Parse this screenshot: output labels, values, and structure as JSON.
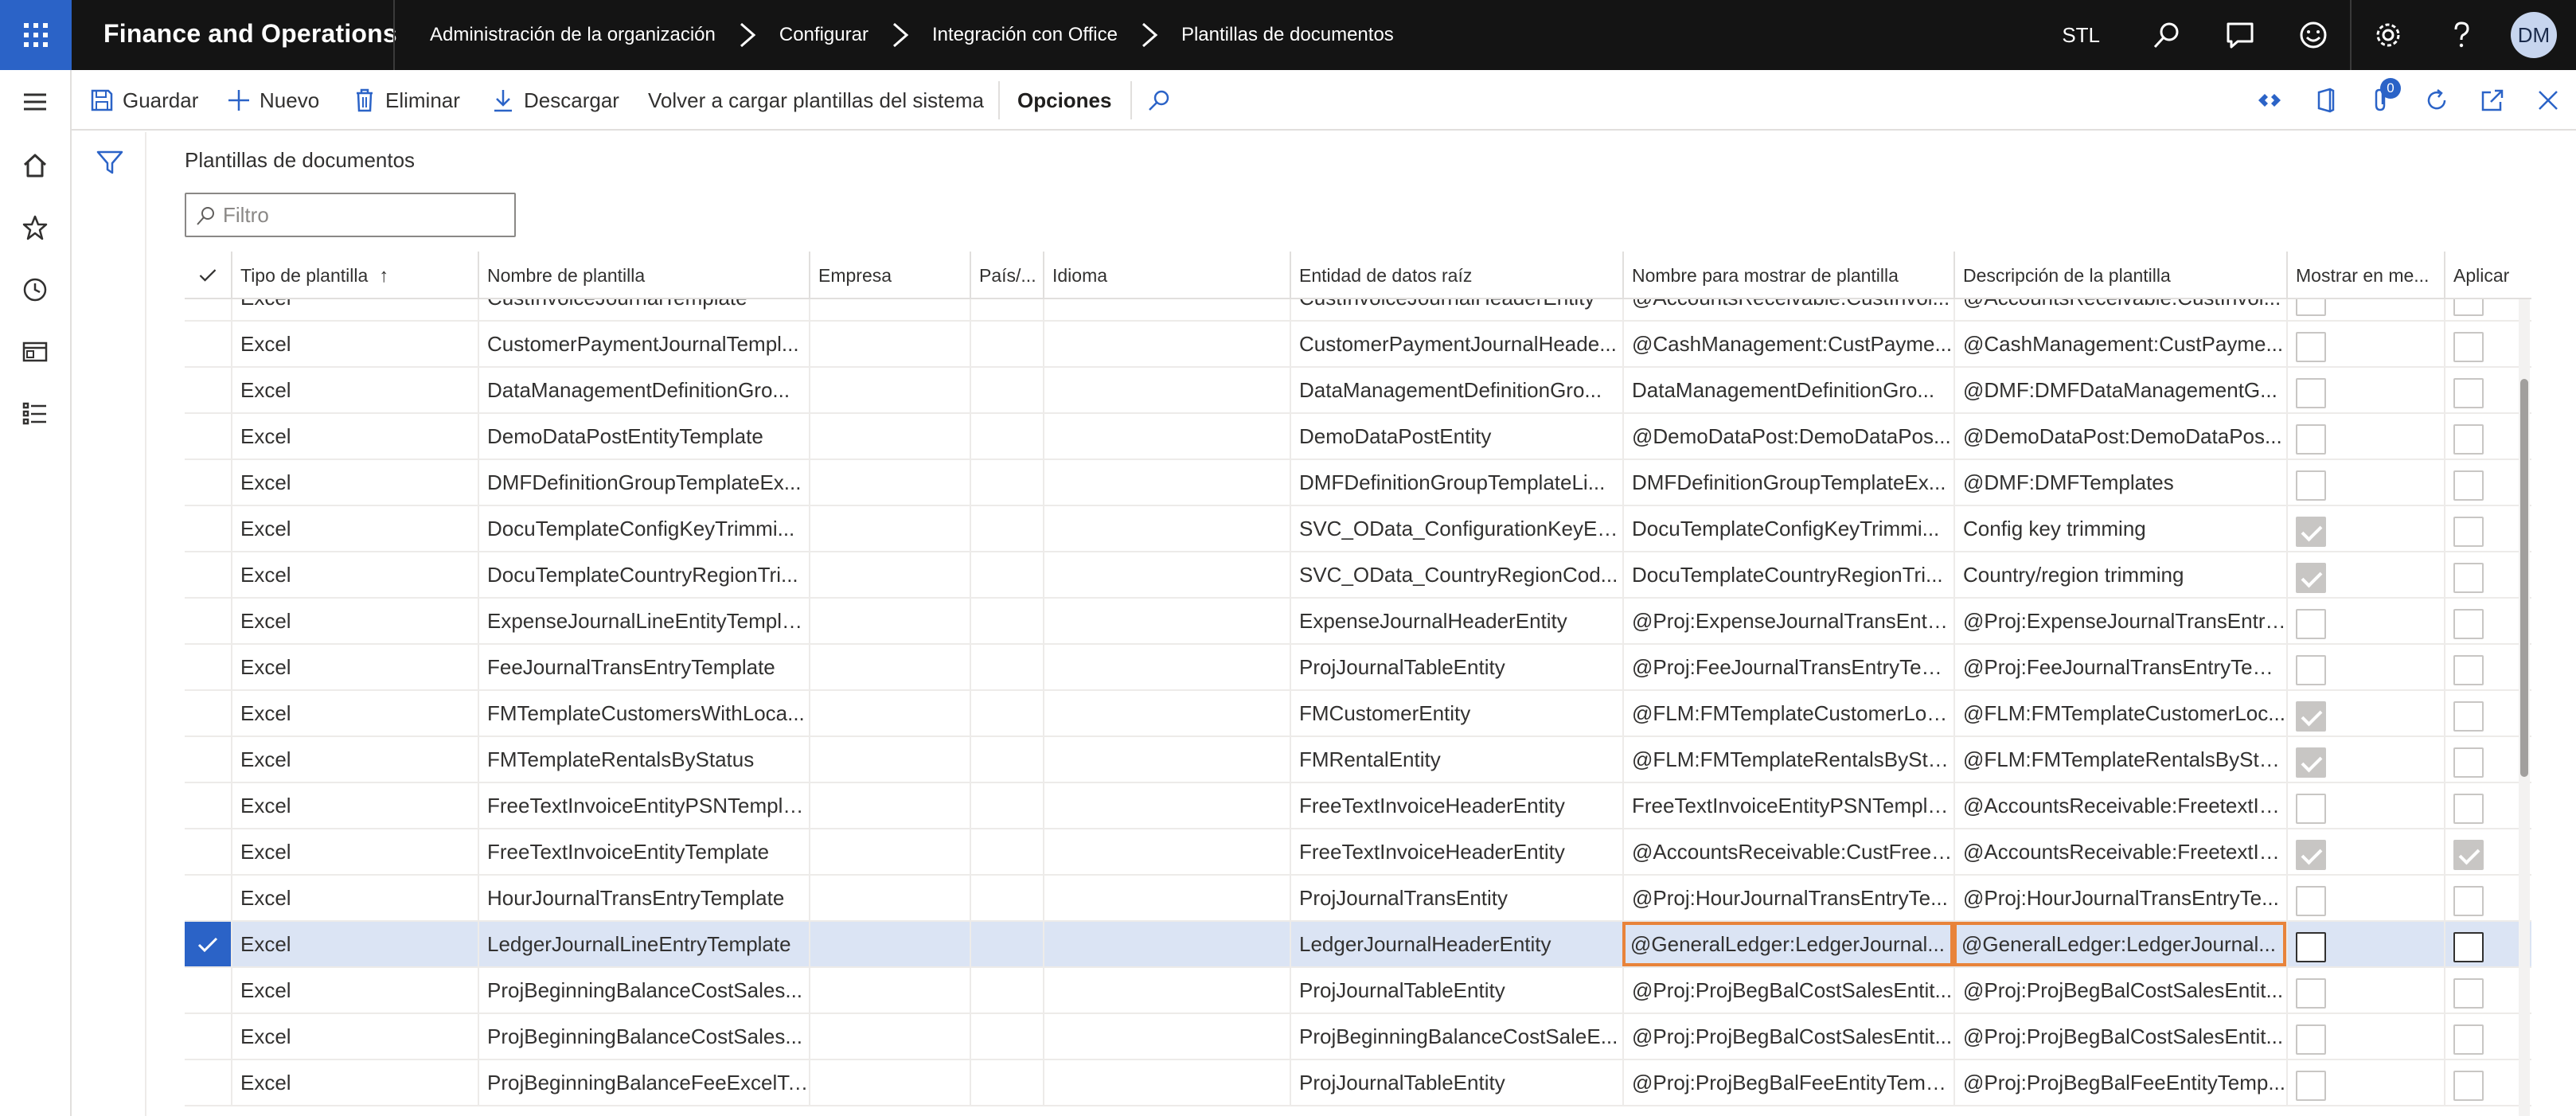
{
  "app": {
    "title": "Finance and Operations",
    "company": "STL",
    "avatar_initials": "DM",
    "accent_color": "#2b63c7",
    "highlight_color": "#e8833a"
  },
  "breadcrumb": [
    "Administración de la organización",
    "Configurar",
    "Integración con Office",
    "Plantillas de documentos"
  ],
  "actions": {
    "save": "Guardar",
    "new": "Nuevo",
    "delete": "Eliminar",
    "download": "Descargar",
    "reload": "Volver a cargar plantillas del sistema",
    "options": "Opciones"
  },
  "notification_count": "0",
  "page": {
    "title": "Plantillas de documentos",
    "filter_placeholder": "Filtro"
  },
  "grid": {
    "columns": [
      "Tipo de plantilla",
      "Nombre de plantilla",
      "Empresa",
      "País/...",
      "Idioma",
      "Entidad de datos raíz",
      "Nombre para mostrar de plantilla",
      "Descripción de la plantilla",
      "Mostrar en me...",
      "Aplicar"
    ],
    "sort_indicator": "↑",
    "rows": [
      {
        "type": "Excel",
        "name": "CustInvoiceJournalTemplate",
        "entity": "CustInvoiceJournalHeaderEntity",
        "display": "@AccountsReceivable:CustInvoi...",
        "desc": "@AccountsReceivable:CustInvoi...",
        "show": false,
        "apply": false
      },
      {
        "type": "Excel",
        "name": "CustomerPaymentJournalTempl...",
        "entity": "CustomerPaymentJournalHeade...",
        "display": "@CashManagement:CustPayme...",
        "desc": "@CashManagement:CustPayme...",
        "show": false,
        "apply": false
      },
      {
        "type": "Excel",
        "name": "DataManagementDefinitionGro...",
        "entity": "DataManagementDefinitionGro...",
        "display": "DataManagementDefinitionGro...",
        "desc": "@DMF:DMFDataManagementG...",
        "show": false,
        "apply": false
      },
      {
        "type": "Excel",
        "name": "DemoDataPostEntityTemplate",
        "entity": "DemoDataPostEntity",
        "display": "@DemoDataPost:DemoDataPos...",
        "desc": "@DemoDataPost:DemoDataPos...",
        "show": false,
        "apply": false
      },
      {
        "type": "Excel",
        "name": "DMFDefinitionGroupTemplateEx...",
        "entity": "DMFDefinitionGroupTemplateLi...",
        "display": "DMFDefinitionGroupTemplateEx...",
        "desc": "@DMF:DMFTemplates",
        "show": false,
        "apply": false
      },
      {
        "type": "Excel",
        "name": "DocuTemplateConfigKeyTrimmi...",
        "entity": "SVC_OData_ConfigurationKeyEn...",
        "display": "DocuTemplateConfigKeyTrimmi...",
        "desc": "Config key trimming",
        "show": true,
        "apply": false
      },
      {
        "type": "Excel",
        "name": "DocuTemplateCountryRegionTri...",
        "entity": "SVC_OData_CountryRegionCod...",
        "display": "DocuTemplateCountryRegionTri...",
        "desc": "Country/region trimming",
        "show": true,
        "apply": false
      },
      {
        "type": "Excel",
        "name": "ExpenseJournalLineEntityTempla...",
        "entity": "ExpenseJournalHeaderEntity",
        "display": "@Proj:ExpenseJournalTransEntry...",
        "desc": "@Proj:ExpenseJournalTransEntry...",
        "show": false,
        "apply": false
      },
      {
        "type": "Excel",
        "name": "FeeJournalTransEntryTemplate",
        "entity": "ProjJournalTableEntity",
        "display": "@Proj:FeeJournalTransEntryTem...",
        "desc": "@Proj:FeeJournalTransEntryTem...",
        "show": false,
        "apply": false
      },
      {
        "type": "Excel",
        "name": "FMTemplateCustomersWithLoca...",
        "entity": "FMCustomerEntity",
        "display": "@FLM:FMTemplateCustomerLoc...",
        "desc": "@FLM:FMTemplateCustomerLoc...",
        "show": true,
        "apply": false
      },
      {
        "type": "Excel",
        "name": "FMTemplateRentalsByStatus",
        "entity": "FMRentalEntity",
        "display": "@FLM:FMTemplateRentalsBySta...",
        "desc": "@FLM:FMTemplateRentalsBySta...",
        "show": true,
        "apply": false
      },
      {
        "type": "Excel",
        "name": "FreeTextInvoiceEntityPSNTempla...",
        "entity": "FreeTextInvoiceHeaderEntity",
        "display": "FreeTextInvoiceEntityPSNTempla...",
        "desc": "@AccountsReceivable:FreetextIn...",
        "show": false,
        "apply": false
      },
      {
        "type": "Excel",
        "name": "FreeTextInvoiceEntityTemplate",
        "entity": "FreeTextInvoiceHeaderEntity",
        "display": "@AccountsReceivable:CustFreeI...",
        "desc": "@AccountsReceivable:FreetextIn...",
        "show": true,
        "apply": true
      },
      {
        "type": "Excel",
        "name": "HourJournalTransEntryTemplate",
        "entity": "ProjJournalTransEntity",
        "display": "@Proj:HourJournalTransEntryTe...",
        "desc": "@Proj:HourJournalTransEntryTe...",
        "show": false,
        "apply": false
      },
      {
        "type": "Excel",
        "name": "LedgerJournalLineEntryTemplate",
        "entity": "LedgerJournalHeaderEntity",
        "display": "@GeneralLedger:LedgerJournal...",
        "desc": "@GeneralLedger:LedgerJournal...",
        "show": false,
        "apply": false,
        "selected": true
      },
      {
        "type": "Excel",
        "name": "ProjBeginningBalanceCostSales...",
        "entity": "ProjJournalTableEntity",
        "display": "@Proj:ProjBegBalCostSalesEntit...",
        "desc": "@Proj:ProjBegBalCostSalesEntit...",
        "show": false,
        "apply": false
      },
      {
        "type": "Excel",
        "name": "ProjBeginningBalanceCostSales...",
        "entity": "ProjBeginningBalanceCostSaleE...",
        "display": "@Proj:ProjBegBalCostSalesEntit...",
        "desc": "@Proj:ProjBegBalCostSalesEntit...",
        "show": false,
        "apply": false
      },
      {
        "type": "Excel",
        "name": "ProjBeginningBalanceFeeExcelTe...",
        "entity": "ProjJournalTableEntity",
        "display": "@Proj:ProjBegBalFeeEntityTemp...",
        "desc": "@Proj:ProjBegBalFeeEntityTemp...",
        "show": false,
        "apply": false
      }
    ]
  }
}
